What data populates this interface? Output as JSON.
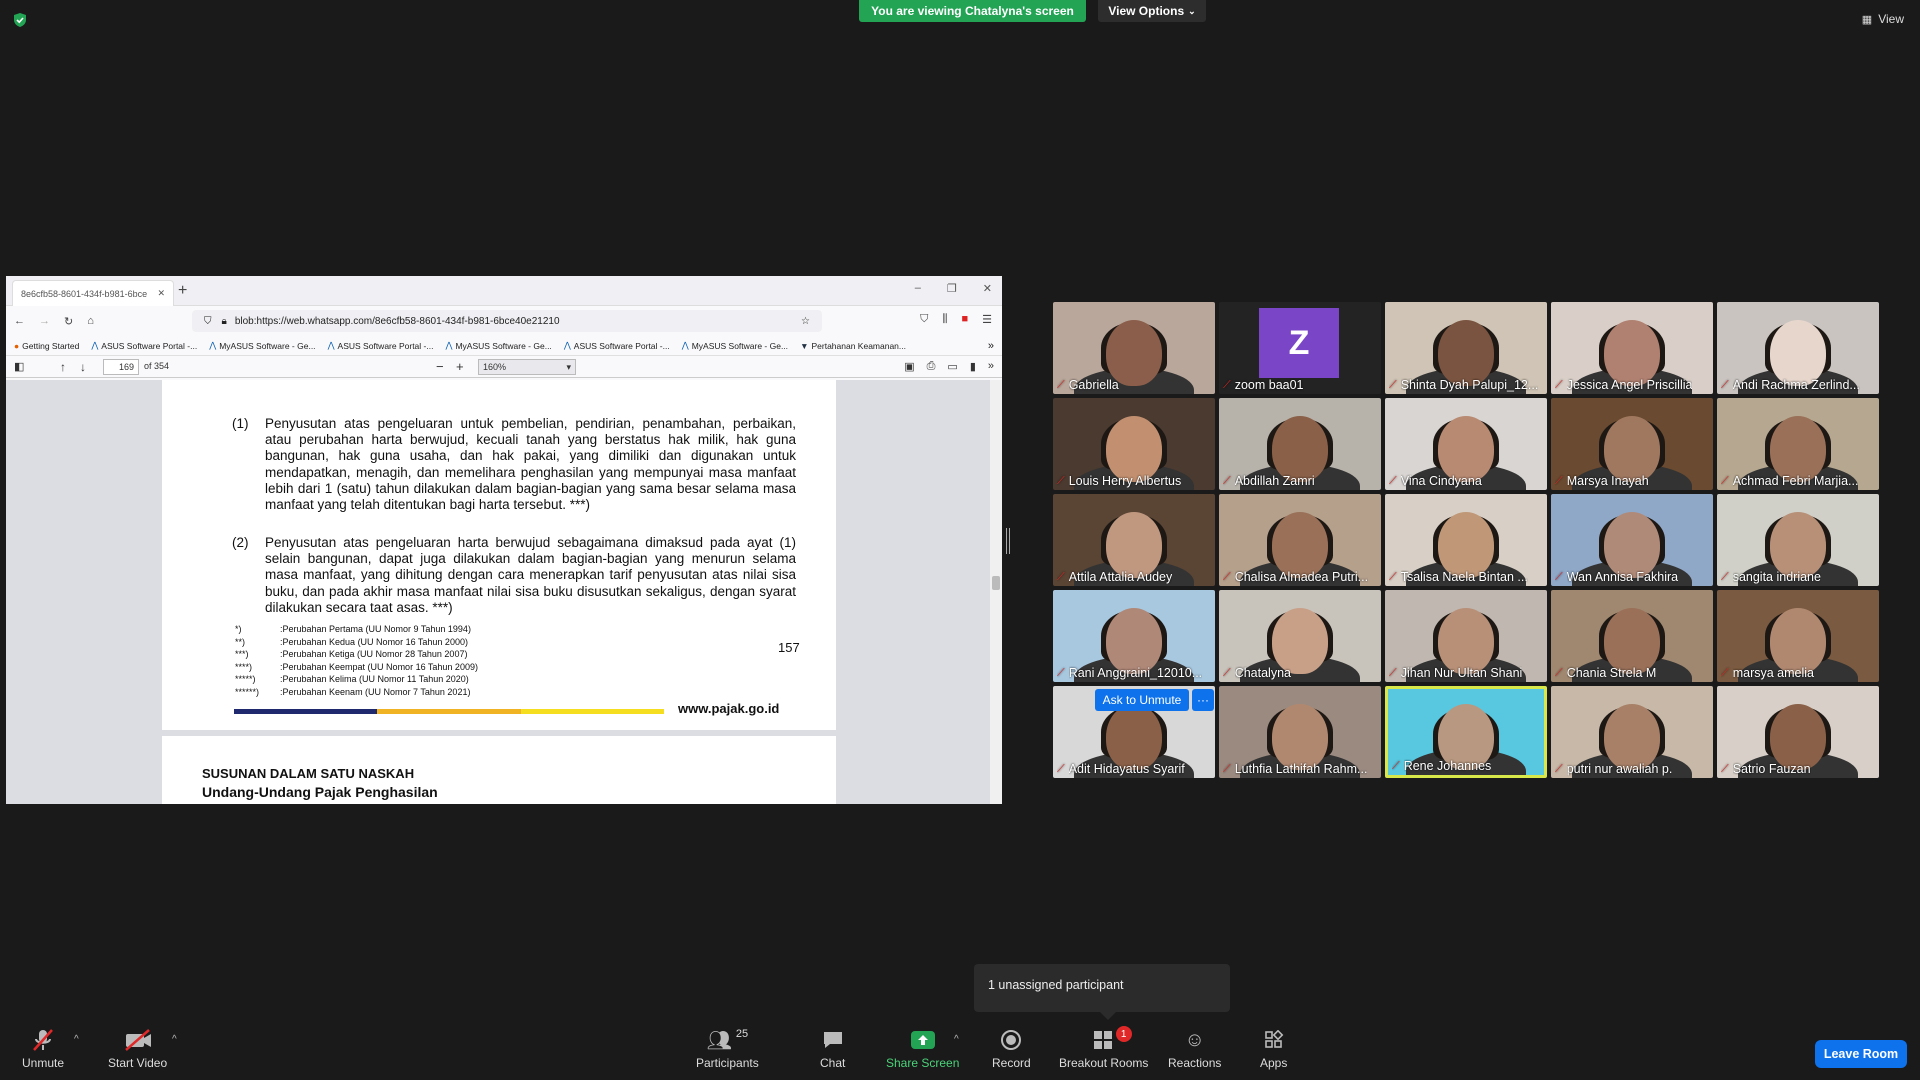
{
  "topbar": {
    "viewing_label": "You are viewing Chatalyna's screen",
    "view_options_label": "View Options",
    "view_label": "View"
  },
  "browser": {
    "tab_title": "8e6cfb58-8601-434f-b981-6bce",
    "url": "blob:https://web.whatsapp.com/8e6cfb58-8601-434f-b981-6bce40e21210",
    "bookmarks": [
      "Getting Started",
      "ASUS Software Portal -...",
      "MyASUS Software - Ge...",
      "ASUS Software Portal -...",
      "MyASUS Software - Ge...",
      "ASUS Software Portal -...",
      "MyASUS Software - Ge...",
      "Pertahanan Keamanan..."
    ],
    "page_current": "169",
    "page_total": "of 354",
    "zoom": "160%"
  },
  "doc": {
    "p1_num": "(1)",
    "p1_text": "Penyusutan atas pengeluaran untuk pembelian, pendirian, penambahan, perbaikan, atau perubahan harta berwujud, kecuali tanah yang berstatus hak milik, hak guna bangunan, hak guna usaha, dan hak pakai, yang dimiliki dan digunakan untuk mendapatkan, menagih, dan memelihara penghasilan yang mempunyai masa manfaat lebih dari 1 (satu) tahun dilakukan dalam bagian-bagian yang sama besar selama masa manfaat yang telah ditentukan bagi harta tersebut. ***)",
    "p2_num": "(2)",
    "p2_text": "Penyusutan atas pengeluaran harta berwujud sebagaimana dimaksud pada ayat (1) selain bangunan, dapat juga dilakukan dalam bagian-bagian yang menurun selama masa manfaat, yang dihitung dengan cara menerapkan tarif penyusutan atas nilai sisa buku, dan pada akhir masa manfaat nilai sisa buku disusutkan sekaligus, dengan syarat dilakukan secara taat asas. ***)",
    "footnotes": [
      {
        "mark": "*)",
        "text": ":Perubahan Pertama (UU Nomor 9 Tahun 1994)"
      },
      {
        "mark": "**)",
        "text": ":Perubahan Kedua (UU Nomor 16 Tahun 2000)"
      },
      {
        "mark": "***)",
        "text": ":Perubahan Ketiga (UU Nomor 28 Tahun 2007)"
      },
      {
        "mark": "****)",
        "text": ":Perubahan Keempat (UU Nomor 16 Tahun 2009)"
      },
      {
        "mark": "*****)",
        "text": ":Perubahan Kelima (UU Nomor 11 Tahun 2020)"
      },
      {
        "mark": "******)",
        "text": ":Perubahan Keenam (UU Nomor 7 Tahun 2021)"
      }
    ],
    "page_number": "157",
    "site": "www.pajak.go.id",
    "page2_title1": "SUSUNAN DALAM SATU NASKAH",
    "page2_title2": "Undang-Undang Pajak Penghasilan"
  },
  "participants_tiles": [
    {
      "name": "Gabriella",
      "bg": "#b9a79b",
      "skin": "#8a5e4a"
    },
    {
      "name": "zoom baa01",
      "bg": "#232323",
      "avatar": "Z"
    },
    {
      "name": "Shinta Dyah Palupi_12...",
      "bg": "#cfc4b5",
      "skin": "#7a5440"
    },
    {
      "name": "Jessica Angel Priscillia",
      "bg": "#d9cfc8",
      "skin": "#b08070"
    },
    {
      "name": "Andi Rachma Zerlind...",
      "bg": "#c9c4c0",
      "skin": "#e6d6cc"
    },
    {
      "name": "Louis Herry Albertus",
      "bg": "#4a3a30",
      "skin": "#c29070"
    },
    {
      "name": "Abdillah Zamri",
      "bg": "#b7b2aa",
      "skin": "#8a6048"
    },
    {
      "name": "Vina Cindyana",
      "bg": "#d8d5d2",
      "skin": "#b88a72"
    },
    {
      "name": "Marsya Inayah",
      "bg": "#6a4a30",
      "skin": "#a07860"
    },
    {
      "name": "Achmad Febri Marjia...",
      "bg": "#b6a890",
      "skin": "#9a7058"
    },
    {
      "name": "Attila Attalia Audey",
      "bg": "#5a4434",
      "skin": "#c09880"
    },
    {
      "name": "Chalisa Almadea Putri...",
      "bg": "#b5a08c",
      "skin": "#9a7058"
    },
    {
      "name": "Tsalisa Naela Bintan ...",
      "bg": "#d8d0c6",
      "skin": "#c09878"
    },
    {
      "name": "Wan Annisa Fakhira",
      "bg": "#8fa8c8",
      "skin": "#b08a78"
    },
    {
      "name": "sangita indriane",
      "bg": "#d0d0c8",
      "skin": "#b89078"
    },
    {
      "name": "Rani Anggraini_12010...",
      "bg": "#a8c8e0",
      "skin": "#b08878"
    },
    {
      "name": "Chatalyna",
      "bg": "#c8c4bc",
      "skin": "#c8a088"
    },
    {
      "name": "Jihan Nur Ultan Shani",
      "bg": "#c0b8b0",
      "skin": "#b89078"
    },
    {
      "name": "Chania Strela M",
      "bg": "#a08870",
      "skin": "#9a7058"
    },
    {
      "name": "marsya amelia",
      "bg": "#7a5a40",
      "skin": "#b08870"
    },
    {
      "name": "Adit Hidayatus Syarif",
      "bg": "#d8d8d8",
      "skin": "#8a6048"
    },
    {
      "name": "Luthfia Lathifah Rahm...",
      "bg": "#9a8a80",
      "skin": "#b08870"
    },
    {
      "name": "Rene Johannes",
      "bg": "#58c8e0",
      "skin": "#b89880"
    },
    {
      "name": "putri nur awaliah p.",
      "bg": "#c8b8a8",
      "skin": "#a88068"
    },
    {
      "name": "Satrio Fauzan",
      "bg": "#d8d0c8",
      "skin": "#8a6048"
    }
  ],
  "ask_to_unmute": "Ask to Unmute",
  "ask_more": "···",
  "unassigned": "1 unassigned participant",
  "toolbar": {
    "unmute": "Unmute",
    "start_video": "Start Video",
    "participants": "Participants",
    "participants_count": "25",
    "chat": "Chat",
    "share_screen": "Share Screen",
    "record": "Record",
    "breakout_rooms": "Breakout Rooms",
    "breakout_badge": "1",
    "reactions": "Reactions",
    "apps": "Apps",
    "leave": "Leave Room"
  },
  "colors": {
    "share_green": "#23a455",
    "zoom_blue": "#0e72ed",
    "muted_red": "#e02828",
    "active_speaker": "#d8e84a"
  }
}
